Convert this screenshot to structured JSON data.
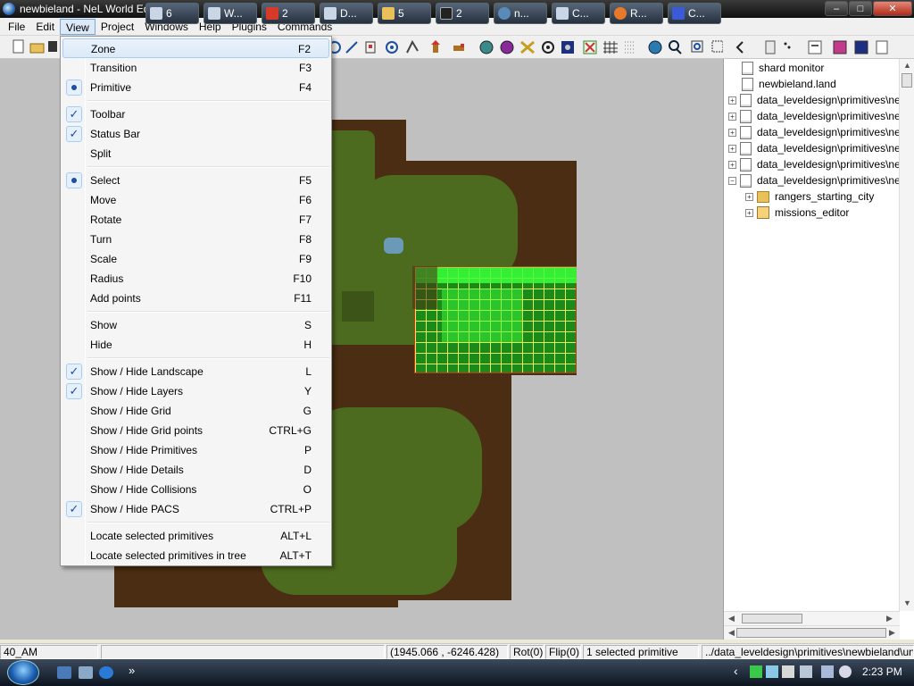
{
  "window": {
    "title": "newbieland - NeL World Editor",
    "minimize_glyph": "–",
    "maximize_glyph": "□",
    "close_glyph": "✕"
  },
  "menubar": {
    "items": [
      {
        "label": "File"
      },
      {
        "label": "Edit"
      },
      {
        "label": "View"
      },
      {
        "label": "Project"
      },
      {
        "label": "Windows"
      },
      {
        "label": "Help"
      },
      {
        "label": "Plugins"
      },
      {
        "label": "Commands"
      }
    ],
    "active": "View"
  },
  "view_menu": {
    "items": [
      {
        "label": "Zone",
        "shortcut": "F2",
        "mark": "",
        "highlighted": true
      },
      {
        "label": "Transition",
        "shortcut": "F3",
        "mark": ""
      },
      {
        "label": "Primitive",
        "shortcut": "F4",
        "mark": "radio"
      },
      {
        "label": "Toolbar",
        "shortcut": "",
        "mark": "check"
      },
      {
        "label": "Status Bar",
        "shortcut": "",
        "mark": "check"
      },
      {
        "label": "Split",
        "shortcut": "",
        "mark": ""
      },
      {
        "label": "Select",
        "shortcut": "F5",
        "mark": "radio"
      },
      {
        "label": "Move",
        "shortcut": "F6",
        "mark": ""
      },
      {
        "label": "Rotate",
        "shortcut": "F7",
        "mark": ""
      },
      {
        "label": "Turn",
        "shortcut": "F8",
        "mark": ""
      },
      {
        "label": "Scale",
        "shortcut": "F9",
        "mark": ""
      },
      {
        "label": "Radius",
        "shortcut": "F10",
        "mark": ""
      },
      {
        "label": "Add points",
        "shortcut": "F11",
        "mark": ""
      },
      {
        "label": "Show",
        "shortcut": "S",
        "mark": ""
      },
      {
        "label": "Hide",
        "shortcut": "H",
        "mark": ""
      },
      {
        "label": "Show / Hide Landscape",
        "shortcut": "L",
        "mark": "check"
      },
      {
        "label": "Show / Hide Layers",
        "shortcut": "Y",
        "mark": "check"
      },
      {
        "label": "Show / Hide Grid",
        "shortcut": "G",
        "mark": ""
      },
      {
        "label": "Show / Hide Grid points",
        "shortcut": "CTRL+G",
        "mark": ""
      },
      {
        "label": "Show / Hide Primitives",
        "shortcut": "P",
        "mark": ""
      },
      {
        "label": "Show / Hide Details",
        "shortcut": "D",
        "mark": ""
      },
      {
        "label": "Show / Hide Collisions",
        "shortcut": "O",
        "mark": ""
      },
      {
        "label": "Show / Hide PACS",
        "shortcut": "CTRL+P",
        "mark": "check"
      },
      {
        "label": "Locate selected primitives",
        "shortcut": "ALT+L",
        "mark": ""
      },
      {
        "label": "Locate selected primitives in tree",
        "shortcut": "ALT+T",
        "mark": ""
      }
    ],
    "check_glyph": "✓"
  },
  "tree": {
    "items": [
      {
        "label": "shard monitor",
        "icon": "document-icon",
        "expander": ""
      },
      {
        "label": "newbieland.land",
        "icon": "document-icon",
        "expander": ""
      },
      {
        "label": "data_leveldesign\\primitives\\newbieland",
        "icon": "document-icon",
        "expander": "+"
      },
      {
        "label": "data_leveldesign\\primitives\\newbieland",
        "icon": "document-icon",
        "expander": "+"
      },
      {
        "label": "data_leveldesign\\primitives\\newbieland",
        "icon": "document-icon",
        "expander": "+"
      },
      {
        "label": "data_leveldesign\\primitives\\newbieland",
        "icon": "document-icon",
        "expander": "+"
      },
      {
        "label": "data_leveldesign\\primitives\\newbieland",
        "icon": "document-icon",
        "expander": "+"
      },
      {
        "label": "data_leveldesign\\primitives\\newbieland",
        "icon": "document-icon",
        "expander": "−"
      },
      {
        "label": "rangers_starting_city",
        "icon": "folder-icon",
        "expander": "+"
      },
      {
        "label": "missions_editor",
        "icon": "mission-icon",
        "expander": "+"
      }
    ]
  },
  "statusbar": {
    "zone": "40_AM",
    "empty": "",
    "coords": "(1945.066 , -6246.428)",
    "rot": "Rot(0)",
    "flip": "Flip(0)",
    "selection": "1 selected primitive",
    "path": "../data_leveldesign\\primitives\\newbieland\\units"
  },
  "taskbar": {
    "quick_launch_more": "»",
    "buttons": [
      {
        "label": "6",
        "icon": "network-icon"
      },
      {
        "label": "W...",
        "icon": "window-icon"
      },
      {
        "label": "2",
        "icon": "messenger-icon"
      },
      {
        "label": "D...",
        "icon": "document-icon"
      },
      {
        "label": "5",
        "icon": "folder-icon"
      },
      {
        "label": "2",
        "icon": "console-icon"
      },
      {
        "label": "n...",
        "icon": "nel-icon"
      },
      {
        "label": "C...",
        "icon": "calculator-icon"
      },
      {
        "label": "R...",
        "icon": "firefox-icon"
      },
      {
        "label": "C...",
        "icon": "app-icon"
      }
    ],
    "tray_arrow": "‹",
    "clock": "2:23 PM",
    "colors": {
      "accent": "#1d4fa0",
      "selection_grid": "#e8e85a",
      "zone_border": "#d03020"
    }
  }
}
